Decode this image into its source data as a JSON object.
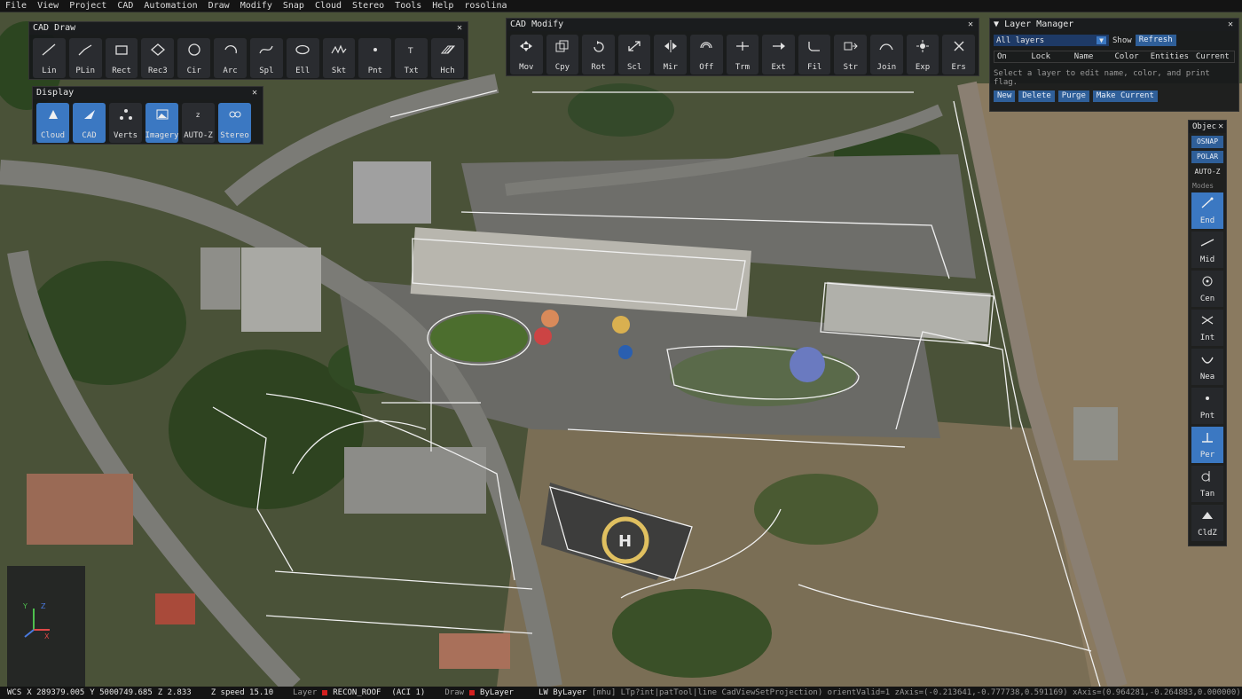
{
  "menu": [
    "File",
    "View",
    "Project",
    "CAD",
    "Automation",
    "Draw",
    "Modify",
    "Snap",
    "Cloud",
    "Stereo",
    "Tools",
    "Help",
    "rosolina"
  ],
  "cad_draw": {
    "title": "CAD Draw",
    "tools": [
      {
        "label": "Lin",
        "icon": "line-icon"
      },
      {
        "label": "PLin",
        "icon": "polyline-icon"
      },
      {
        "label": "Rect",
        "icon": "rectangle-icon"
      },
      {
        "label": "Rec3",
        "icon": "rect3-icon"
      },
      {
        "label": "Cir",
        "icon": "circle-icon"
      },
      {
        "label": "Arc",
        "icon": "arc-icon"
      },
      {
        "label": "Spl",
        "icon": "spline-icon"
      },
      {
        "label": "Ell",
        "icon": "ellipse-icon"
      },
      {
        "label": "Skt",
        "icon": "sketch-icon"
      },
      {
        "label": "Pnt",
        "icon": "point-icon"
      },
      {
        "label": "Txt",
        "icon": "text-icon"
      },
      {
        "label": "Hch",
        "icon": "hatch-icon"
      }
    ]
  },
  "display": {
    "title": "Display",
    "tools": [
      {
        "label": "Cloud",
        "icon": "cloud-icon",
        "active": true
      },
      {
        "label": "CAD",
        "icon": "cad-icon",
        "active": true
      },
      {
        "label": "Verts",
        "icon": "verts-icon",
        "active": false
      },
      {
        "label": "Imagery",
        "icon": "imagery-icon",
        "active": true
      },
      {
        "label": "AUTO-Z",
        "icon": "autoz-icon",
        "active": false
      },
      {
        "label": "Stereo",
        "icon": "stereo-icon",
        "active": true
      }
    ]
  },
  "cad_modify": {
    "title": "CAD Modify",
    "tools": [
      {
        "label": "Mov",
        "icon": "move-icon"
      },
      {
        "label": "Cpy",
        "icon": "copy-icon"
      },
      {
        "label": "Rot",
        "icon": "rotate-icon"
      },
      {
        "label": "Scl",
        "icon": "scale-icon"
      },
      {
        "label": "Mir",
        "icon": "mirror-icon"
      },
      {
        "label": "Off",
        "icon": "offset-icon"
      },
      {
        "label": "Trm",
        "icon": "trim-icon"
      },
      {
        "label": "Ext",
        "icon": "extend-icon"
      },
      {
        "label": "Fil",
        "icon": "fillet-icon"
      },
      {
        "label": "Str",
        "icon": "stretch-icon"
      },
      {
        "label": "Join",
        "icon": "join-icon"
      },
      {
        "label": "Exp",
        "icon": "explode-icon"
      },
      {
        "label": "Ers",
        "icon": "erase-icon"
      }
    ]
  },
  "layer_manager": {
    "title": "Layer Manager",
    "filter": "All layers",
    "show_label": "Show",
    "refresh_label": "Refresh",
    "columns": [
      "On",
      "Lock",
      "Name",
      "Color",
      "Entities",
      "Current"
    ],
    "hint": "Select a layer to edit name, color, and print flag.",
    "buttons": [
      "New",
      "Delete",
      "Purge",
      "Make Current"
    ]
  },
  "snap": {
    "title": "Objec",
    "toggles": [
      {
        "label": "OSNAP",
        "on": true
      },
      {
        "label": "POLAR",
        "on": true
      },
      {
        "label": "AUTO-Z",
        "on": false
      }
    ],
    "modes_label": "Modes",
    "modes": [
      {
        "label": "End",
        "icon": "endpoint-icon",
        "active": true
      },
      {
        "label": "Mid",
        "icon": "midpoint-icon",
        "active": false
      },
      {
        "label": "Cen",
        "icon": "center-icon",
        "active": false
      },
      {
        "label": "Int",
        "icon": "intersection-icon",
        "active": false
      },
      {
        "label": "Nea",
        "icon": "nearest-icon",
        "active": false
      },
      {
        "label": "Pnt",
        "icon": "node-icon",
        "active": false
      },
      {
        "label": "Per",
        "icon": "perpendicular-icon",
        "active": true
      },
      {
        "label": "Tan",
        "icon": "tangent-icon",
        "active": false
      },
      {
        "label": "CldZ",
        "icon": "cloudz-icon",
        "active": false
      }
    ]
  },
  "status": {
    "wcs": "WCS",
    "x": "X 289379.005",
    "y": "Y 5000749.685",
    "z": "Z 2.833",
    "zspeed": "Z speed 15.10",
    "layer_label": "Layer",
    "layer_name": "RECON_ROOF",
    "layer_aci": "(ACI 1)",
    "draw_label": "Draw",
    "draw_value": "ByLayer",
    "lw": "LW ByLayer",
    "debug": "[mhu] LTp?int|patTool|line CadViewSetProjection) orientValid=1 zAxis=(-0.213641,-0.777738,0.591169) xAxis=(0.964281,-0.264883,0.000000)"
  },
  "colors": {
    "accent": "#3b78c2",
    "layer_swatch": "#d42020"
  }
}
